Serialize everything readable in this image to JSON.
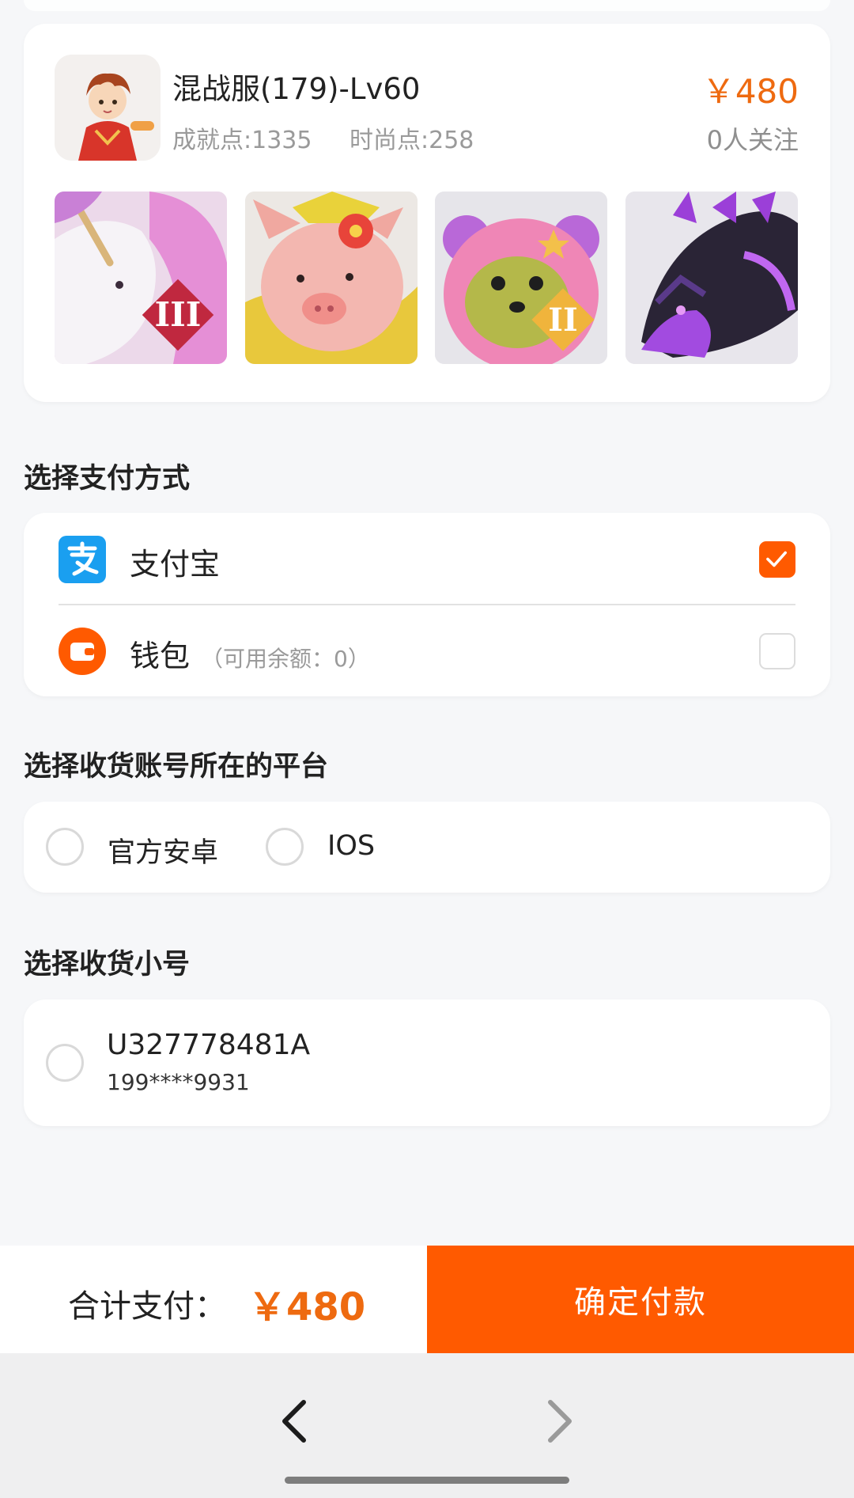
{
  "product": {
    "name": "混战服(179)-Lv60",
    "achievement": "成就点:1335",
    "fashion": "时尚点:258",
    "price": "￥480",
    "followers": "0人关注",
    "thumb_badges": [
      "III",
      "",
      "II",
      ""
    ]
  },
  "payment": {
    "title": "选择支付方式",
    "options": [
      {
        "label": "支付宝",
        "sub": "",
        "checked": true
      },
      {
        "label": "钱包",
        "sub": "（可用余额：0）",
        "checked": false
      }
    ]
  },
  "platform": {
    "title": "选择收货账号所在的平台",
    "options": [
      "官方安卓",
      "IOS"
    ]
  },
  "account": {
    "title": "选择收货小号",
    "id": "U327778481A",
    "phone": "199****9931"
  },
  "footer": {
    "total_label": "合计支付：",
    "total_amount": "￥480",
    "pay_button": "确定付款"
  },
  "colors": {
    "accent": "#ff5a00",
    "price": "#ee6a10",
    "alipay": "#1a9ff0"
  }
}
